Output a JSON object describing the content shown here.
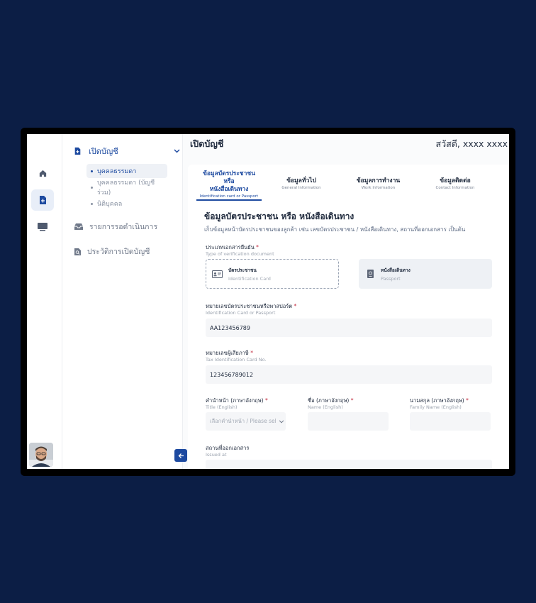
{
  "sidebar": {
    "menu_open_account": "เปิดบัญชี",
    "sub_items": [
      "บุคคลธรรมดา",
      "บุคคลธรรมดา (บัญชีร่วม)",
      "นิติบุคคล"
    ],
    "menu_pending": "รายการรอดำเนินการ",
    "menu_history": "ประวัติการเปิดบัญชี"
  },
  "header": {
    "title": "เปิดบัญชี",
    "greeting": "สวัสดี, xxxx xxxx"
  },
  "steps": [
    {
      "title_line1": "ข้อมูลบัตรประชาชน หรือ",
      "title_line2": "หนังสือเดินทาง",
      "subtitle": "Identification card or Passport"
    },
    {
      "title_line1": "ข้อมูลทั่วไป",
      "title_line2": "",
      "subtitle": "General Information"
    },
    {
      "title_line1": "ข้อมูลการทำงาน",
      "title_line2": "",
      "subtitle": "Work Information"
    },
    {
      "title_line1": "ข้อมูลติดต่อ",
      "title_line2": "",
      "subtitle": "Contact Information"
    }
  ],
  "section": {
    "title": "ข้อมูลบัตรประชาชน หรือ หนังสือเดินทาง",
    "description": "เก็บข้อมูลหน้าบัตรประชาชนของลูกค้า เช่น เลขบัตรประชาชน / หนังสือเดินทาง, สถานที่ออกเอกสาร เป็นต้น"
  },
  "doc_type": {
    "label": "ประเภทเอกสารยืนยัน",
    "sublabel": "Type of verification document",
    "options": [
      {
        "title": "บัตรประชาชน",
        "subtitle": "Identification Card"
      },
      {
        "title": "หนังสือเดินทาง",
        "subtitle": "Passport"
      }
    ]
  },
  "id_number": {
    "label": "หมายเลขบัตรประชาชนหรือพาสปอร์ต",
    "sublabel": "Identification Card or Passport",
    "value": "AA123456789"
  },
  "tax_id": {
    "label": "หมายเลขผู้เสียภาษี",
    "sublabel": "Tax Identification Card No.",
    "value": "123456789012"
  },
  "title_en": {
    "label": "คำนำหน้า (ภาษาอังกฤษ)",
    "sublabel": "Title (English)",
    "placeholder": "เลือกคำนำหน้า / Please sele"
  },
  "name_en": {
    "label": "ชื่อ (ภาษาอังกฤษ)",
    "sublabel": "Name (English)",
    "value": ""
  },
  "family_en": {
    "label": "นามสกุล (ภาษาอังกฤษ)",
    "sublabel": "Family Name (English)",
    "value": ""
  },
  "issued_at": {
    "label": "สถานที่ออกเอกสาร",
    "sublabel": "Issued at"
  },
  "required_mark": "*",
  "colors": {
    "primary": "#1d4aa0",
    "background": "#0c1e45",
    "required": "#c0263a"
  }
}
